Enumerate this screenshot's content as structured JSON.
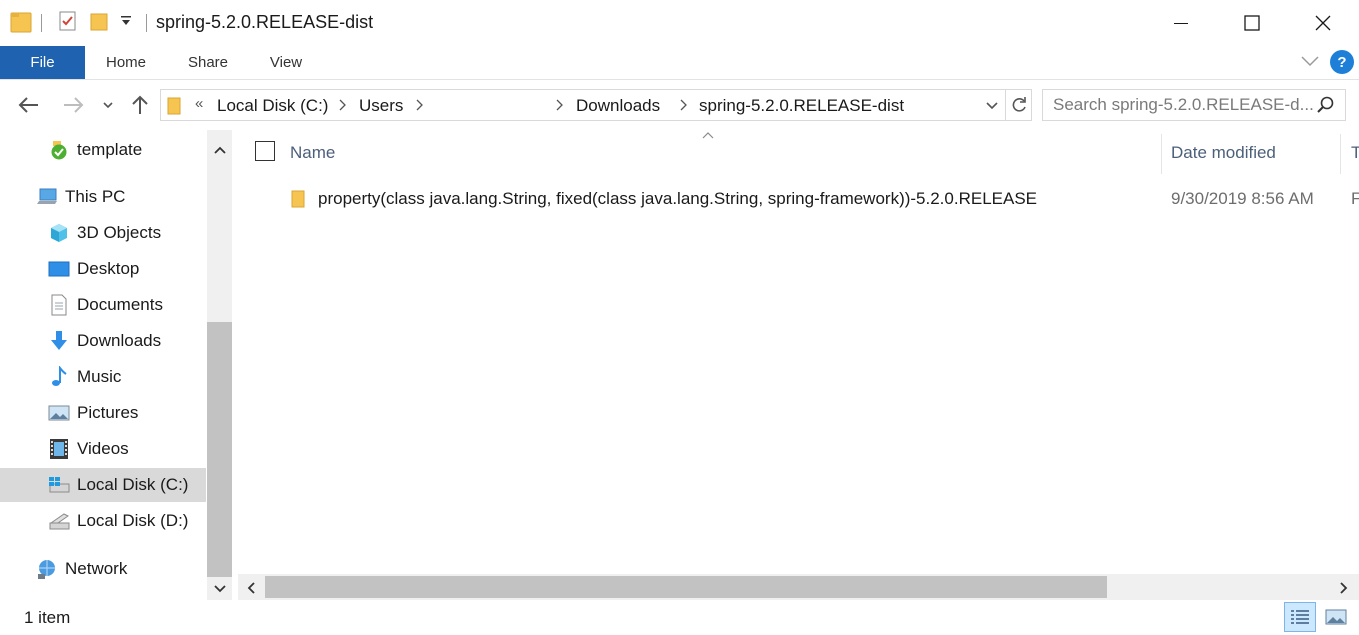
{
  "window": {
    "title": "spring-5.2.0.RELEASE-dist",
    "minimize_icon": "minimize-icon",
    "maximize_icon": "maximize-icon",
    "close_icon": "close-icon"
  },
  "ribbon": {
    "tabs": [
      {
        "label": "File"
      },
      {
        "label": "Home"
      },
      {
        "label": "Share"
      },
      {
        "label": "View"
      }
    ],
    "help_label": "?"
  },
  "address": {
    "prefix": "«",
    "crumbs": [
      {
        "label": "Local Disk (C:)"
      },
      {
        "label": "Users"
      },
      {
        "label": "Downloads"
      },
      {
        "label": "spring-5.2.0.RELEASE-dist"
      }
    ]
  },
  "search": {
    "placeholder": "Search spring-5.2.0.RELEASE-d..."
  },
  "nav": {
    "items": [
      {
        "label": "template",
        "icon": "green-check-folder-icon"
      },
      {
        "label": "This PC",
        "icon": "computer-icon"
      },
      {
        "label": "3D Objects",
        "icon": "cube-icon"
      },
      {
        "label": "Desktop",
        "icon": "desktop-icon"
      },
      {
        "label": "Documents",
        "icon": "document-icon"
      },
      {
        "label": "Downloads",
        "icon": "download-arrow-icon"
      },
      {
        "label": "Music",
        "icon": "music-note-icon"
      },
      {
        "label": "Pictures",
        "icon": "picture-icon"
      },
      {
        "label": "Videos",
        "icon": "film-icon"
      },
      {
        "label": "Local Disk (C:)",
        "icon": "windows-drive-icon"
      },
      {
        "label": "Local Disk (D:)",
        "icon": "drive-icon"
      },
      {
        "label": "Network",
        "icon": "network-icon"
      }
    ]
  },
  "columns": {
    "name": "Name",
    "date_modified": "Date modified",
    "type_partial": "T"
  },
  "files": [
    {
      "name": "property(class java.lang.String, fixed(class java.lang.String, spring-framework))-5.2.0.RELEASE",
      "date_modified": "9/30/2019 8:56 AM",
      "type_partial": "F"
    }
  ],
  "status": {
    "item_count": "1 item"
  },
  "colors": {
    "file_tab": "#1e62b0",
    "selected_nav": "#d9d9d9",
    "folder": "#f5c451",
    "help_badge": "#1e7fd8"
  }
}
